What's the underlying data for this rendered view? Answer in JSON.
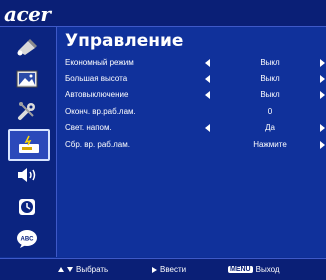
{
  "brand": "acer",
  "page_title": "Управление",
  "sidebar": {
    "items": [
      {
        "icon": "color-icon",
        "active": false
      },
      {
        "icon": "image-icon",
        "active": false
      },
      {
        "icon": "settings-icon",
        "active": false
      },
      {
        "icon": "management-icon",
        "active": true
      },
      {
        "icon": "audio-icon",
        "active": false
      },
      {
        "icon": "timer-icon",
        "active": false
      },
      {
        "icon": "language-icon",
        "active": false,
        "label": "ABC"
      }
    ]
  },
  "settings": [
    {
      "label": "Економный режим",
      "value": "Выкл",
      "left_arrow": true,
      "right_arrow": true
    },
    {
      "label": "Большая высота",
      "value": "Выкл",
      "left_arrow": true,
      "right_arrow": true
    },
    {
      "label": "Автовыключение",
      "value": "Выкл",
      "left_arrow": true,
      "right_arrow": true
    },
    {
      "label": "Оконч. вр.раб.лам.",
      "value": "0",
      "left_arrow": false,
      "right_arrow": false
    },
    {
      "label": "Свет. напом.",
      "value": "Да",
      "left_arrow": true,
      "right_arrow": true
    },
    {
      "label": "Сбр. вр. раб.лам.",
      "value": "Нажмите",
      "left_arrow": false,
      "right_arrow": true
    }
  ],
  "footer": {
    "select_label": "Выбрать",
    "enter_label": "Ввести",
    "menu_key": "MENU",
    "exit_label": "Выход"
  },
  "colors": {
    "background": "#0f2f94",
    "bars": "#0a1f76",
    "text": "#ffffff"
  }
}
